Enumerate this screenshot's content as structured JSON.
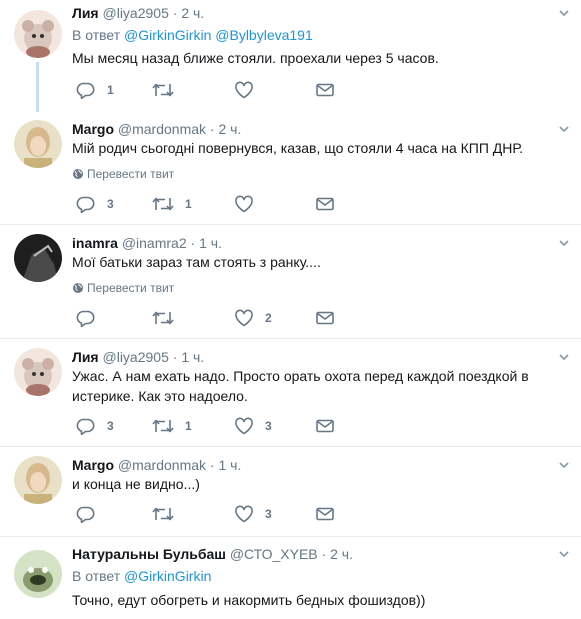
{
  "ui": {
    "translate_label": "Перевести твит",
    "reply_prefix": "В ответ"
  },
  "colors": {
    "link": "#1b95e0",
    "muted": "#657786",
    "thread_line": "#c4dfef"
  },
  "tweets": [
    {
      "name": "Лия",
      "handle": "@liya2905",
      "time": "2 ч.",
      "reply_to": [
        "@GirkinGirkin",
        "@Bylbyleva191"
      ],
      "text": "Мы месяц назад ближе стояли. проехали через 5 часов.",
      "replies": "1",
      "retweets": "",
      "likes": ""
    },
    {
      "name": "Margo",
      "handle": "@mardonmak",
      "time": "2 ч.",
      "text": "Мій родич сьогодні повернувся, казав, що стояли 4 часа на КПП ДНР.",
      "replies": "3",
      "retweets": "1",
      "likes": ""
    },
    {
      "name": "inamra",
      "handle": "@inamra2",
      "time": "1 ч.",
      "text": "Мої батьки зараз там стоять з ранку....",
      "replies": "",
      "retweets": "",
      "likes": "2"
    },
    {
      "name": "Лия",
      "handle": "@liya2905",
      "time": "1 ч.",
      "text": "Ужас. А нам ехать надо. Просто орать охота перед каждой поездкой в истерике. Как это надоело.",
      "replies": "3",
      "retweets": "1",
      "likes": "3"
    },
    {
      "name": "Margo",
      "handle": "@mardonmak",
      "time": "1 ч.",
      "text": "и конца не видно...)",
      "replies": "",
      "retweets": "",
      "likes": "3"
    },
    {
      "name": "Натуральны Бульбаш",
      "handle": "@СТО_XYEB",
      "time": "2 ч.",
      "reply_to": [
        "@GirkinGirkin"
      ],
      "text": "Точно, едут обогреть и накормить бедных фошиздов))"
    }
  ]
}
